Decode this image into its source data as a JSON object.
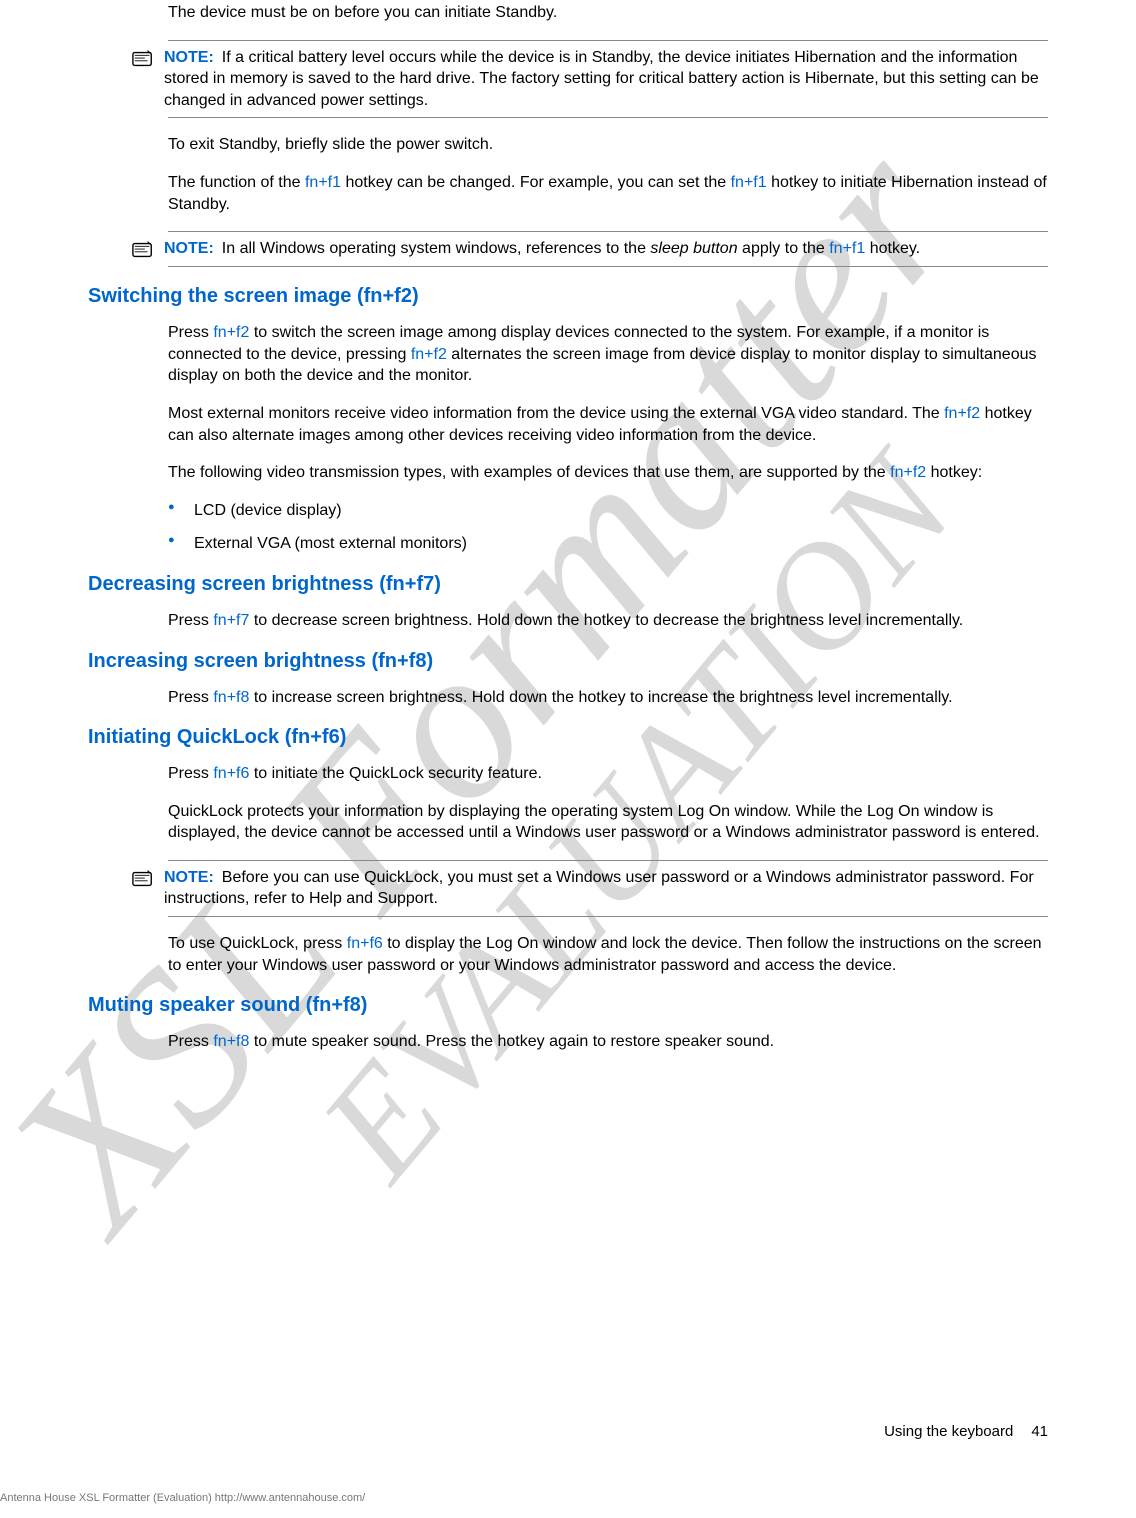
{
  "intro": {
    "p1": "The device must be on before you can initiate Standby."
  },
  "note1": {
    "label": "NOTE:",
    "text_a": "If a critical battery level occurs while the device is in Standby, the device initiates Hibernation and the information stored in memory is saved to the hard drive. The factory setting for critical battery action is Hibernate, but this setting can be changed in advanced power settings."
  },
  "standby": {
    "p_exit": "To exit Standby, briefly slide the power switch.",
    "p_func_a": "The function of the ",
    "k1": "fn+f1",
    "p_func_b": " hotkey can be changed. For example, you can set the ",
    "k2": "fn+f1",
    "p_func_c": " hotkey to initiate Hibernation instead of Standby."
  },
  "note2": {
    "label": "NOTE:",
    "text_a": "In all Windows operating system windows, references to the ",
    "sleep": "sleep button",
    "text_b": " apply to the ",
    "k": "fn+f1",
    "text_c": " hotkey."
  },
  "switching": {
    "heading": "Switching the screen image (fn+f2)",
    "p1_a": "Press ",
    "k1": "fn+f2",
    "p1_b": " to switch the screen image among display devices connected to the system. For example, if a monitor is connected to the device, pressing ",
    "k2": "fn+f2",
    "p1_c": " alternates the screen image from device display to monitor display to simultaneous display on both the device and the monitor.",
    "p2_a": "Most external monitors receive video information from the device using the external VGA video standard. The ",
    "k3": "fn+f2",
    "p2_b": " hotkey can also alternate images among other devices receiving video information from the device.",
    "p3_a": "The following video transmission types, with examples of devices that use them, are supported by the ",
    "k4": "fn+f2",
    "p3_b": " hotkey:",
    "bullets": {
      "b1": "LCD (device display)",
      "b2": "External VGA (most external monitors)"
    }
  },
  "dec_bright": {
    "heading": "Decreasing screen brightness (fn+f7)",
    "p_a": "Press ",
    "k": "fn+f7",
    "p_b": " to decrease screen brightness. Hold down the hotkey to decrease the brightness level incrementally."
  },
  "inc_bright": {
    "heading": "Increasing screen brightness (fn+f8)",
    "p_a": "Press ",
    "k": "fn+f8",
    "p_b": " to increase screen brightness. Hold down the hotkey to increase the brightness level incrementally."
  },
  "quicklock": {
    "heading": "Initiating QuickLock (fn+f6)",
    "p1_a": "Press ",
    "k1": "fn+f6",
    "p1_b": " to initiate the QuickLock security feature.",
    "p2": "QuickLock protects your information by displaying the operating system Log On window. While the Log On window is displayed, the device cannot be accessed until a Windows user password or a Windows administrator password is entered.",
    "note": {
      "label": "NOTE:",
      "text": "Before you can use QuickLock, you must set a Windows user password or a Windows administrator password. For instructions, refer to Help and Support."
    },
    "p3_a": "To use QuickLock, press ",
    "k2": "fn+f6",
    "p3_b": " to display the Log On window and lock the device. Then follow the instructions on the screen to enter your Windows user password or your Windows administrator password and access the device."
  },
  "mute": {
    "heading": "Muting speaker sound (fn+f8)",
    "p_a": "Press ",
    "k": "fn+f8",
    "p_b": " to mute speaker sound. Press the hotkey again to restore speaker sound."
  },
  "footer": {
    "right_label": "Using the keyboard",
    "right_page": "41",
    "left": "Antenna House XSL Formatter (Evaluation)  http://www.antennahouse.com/"
  },
  "watermark": {
    "big": "XSL Formatter",
    "small": "EVALUATION"
  }
}
